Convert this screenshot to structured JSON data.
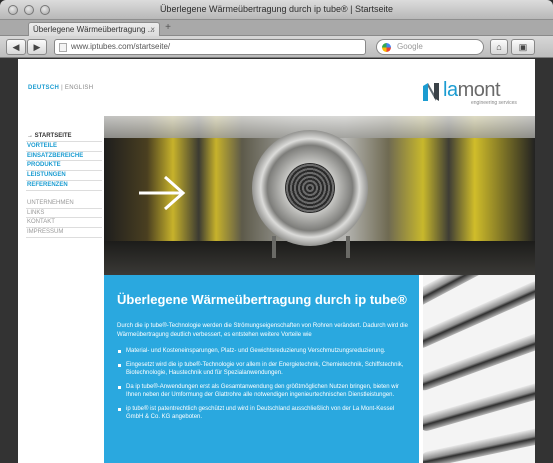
{
  "window": {
    "title": "Überlegene Wärmeübertragung durch ip tube® | Startseite"
  },
  "tab": {
    "label": "Überlegene Wärmeübertragung ...",
    "close": "×",
    "new": "+"
  },
  "toolbar": {
    "back": "◀",
    "forward": "▶",
    "url": "www.iptubes.com/startseite/",
    "search_placeholder": "Google",
    "home": "⌂",
    "bookmarks": "▣"
  },
  "lang": {
    "active": "DEUTSCH",
    "sep": " | ",
    "other": "ENGLISH"
  },
  "logo": {
    "word_a": "la",
    "word_b": "mont",
    "sub": "engineering services"
  },
  "nav": {
    "primary": [
      "→ STARTSEITE",
      "VORTEILE",
      "EINSATZBEREICHE",
      "PRODUKTE",
      "LEISTUNGEN",
      "REFERENZEN"
    ],
    "secondary": [
      "UNTERNEHMEN",
      "LINKS",
      "KONTAKT",
      "IMPRESSUM"
    ]
  },
  "content": {
    "headline": "Überlegene Wärmeübertragung durch ip tube®",
    "intro": "Durch die ip tube®-Technologie werden die Strömungseigenschaften von Rohren verändert. Dadurch wird die Wärmeübertragung deutlich verbessert, es entstehen weitere Vorteile wie",
    "bullets": [
      "Material- und Kosteneinsparungen, Platz- und Gewichtsreduzierung Verschmutzungsreduzierung.",
      "Eingesetzt wird die ip tube®-Technologie vor allem in der Energietechnik, Chemietechnik, Schiffstechnik, Biotechnologie, Haustechnik und für Spezialanwendungen.",
      "Da ip tube®-Anwendungen erst als Gesamtanwendung den größtmöglichen Nutzen bringen, bieten wir Ihnen neben der Umformung der Glattrohre alle notwendigen ingenieurtechnischen Dienstleistungen.",
      "ip tube® ist patentrechtlich geschützt und wird in Deutschland ausschließlich von der La Mont-Kessel GmbH & Co. KG angeboten."
    ]
  },
  "colors": {
    "accent": "#2aa8df",
    "link": "#1b9cd1"
  }
}
